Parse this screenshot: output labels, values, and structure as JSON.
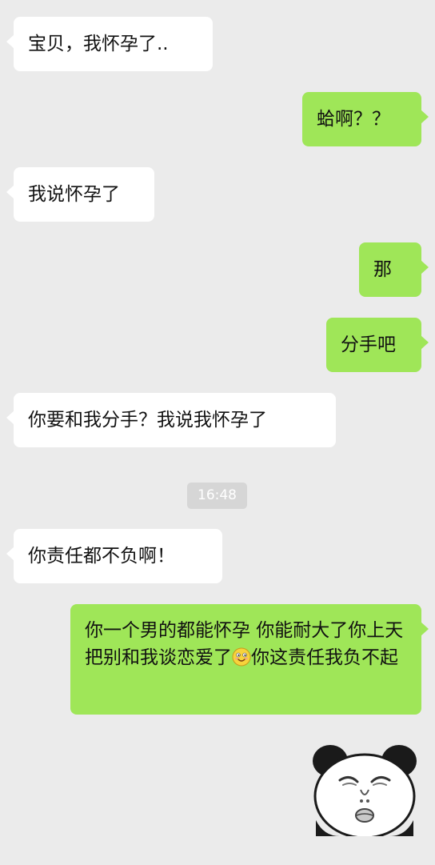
{
  "conversation": {
    "messages": [
      {
        "side": "left",
        "text": "宝贝，我怀孕了.."
      },
      {
        "side": "right",
        "text": "蛤啊？？"
      },
      {
        "side": "left",
        "text": "我说怀孕了"
      },
      {
        "side": "right",
        "text": "那"
      },
      {
        "side": "right",
        "text": "分手吧"
      },
      {
        "side": "left",
        "text": "你要和我分手？我说我怀孕了"
      },
      {
        "side": "left",
        "text": "你责任都不负啊！"
      },
      {
        "side": "right",
        "text_before_emoji": "你一个男的都能怀孕 你能耐大了你上天把别和我谈恋爱了",
        "emoji": "smiley-emoji",
        "text_after_emoji": "你这责任我负不起"
      }
    ],
    "timestamp": "16:48",
    "sticker": {
      "icon": "panda-face-sticker"
    }
  },
  "colors": {
    "background": "#ebebeb",
    "sent_bubble": "#9fe658",
    "received_bubble": "#ffffff",
    "timestamp_bg": "#d6d6d6"
  }
}
